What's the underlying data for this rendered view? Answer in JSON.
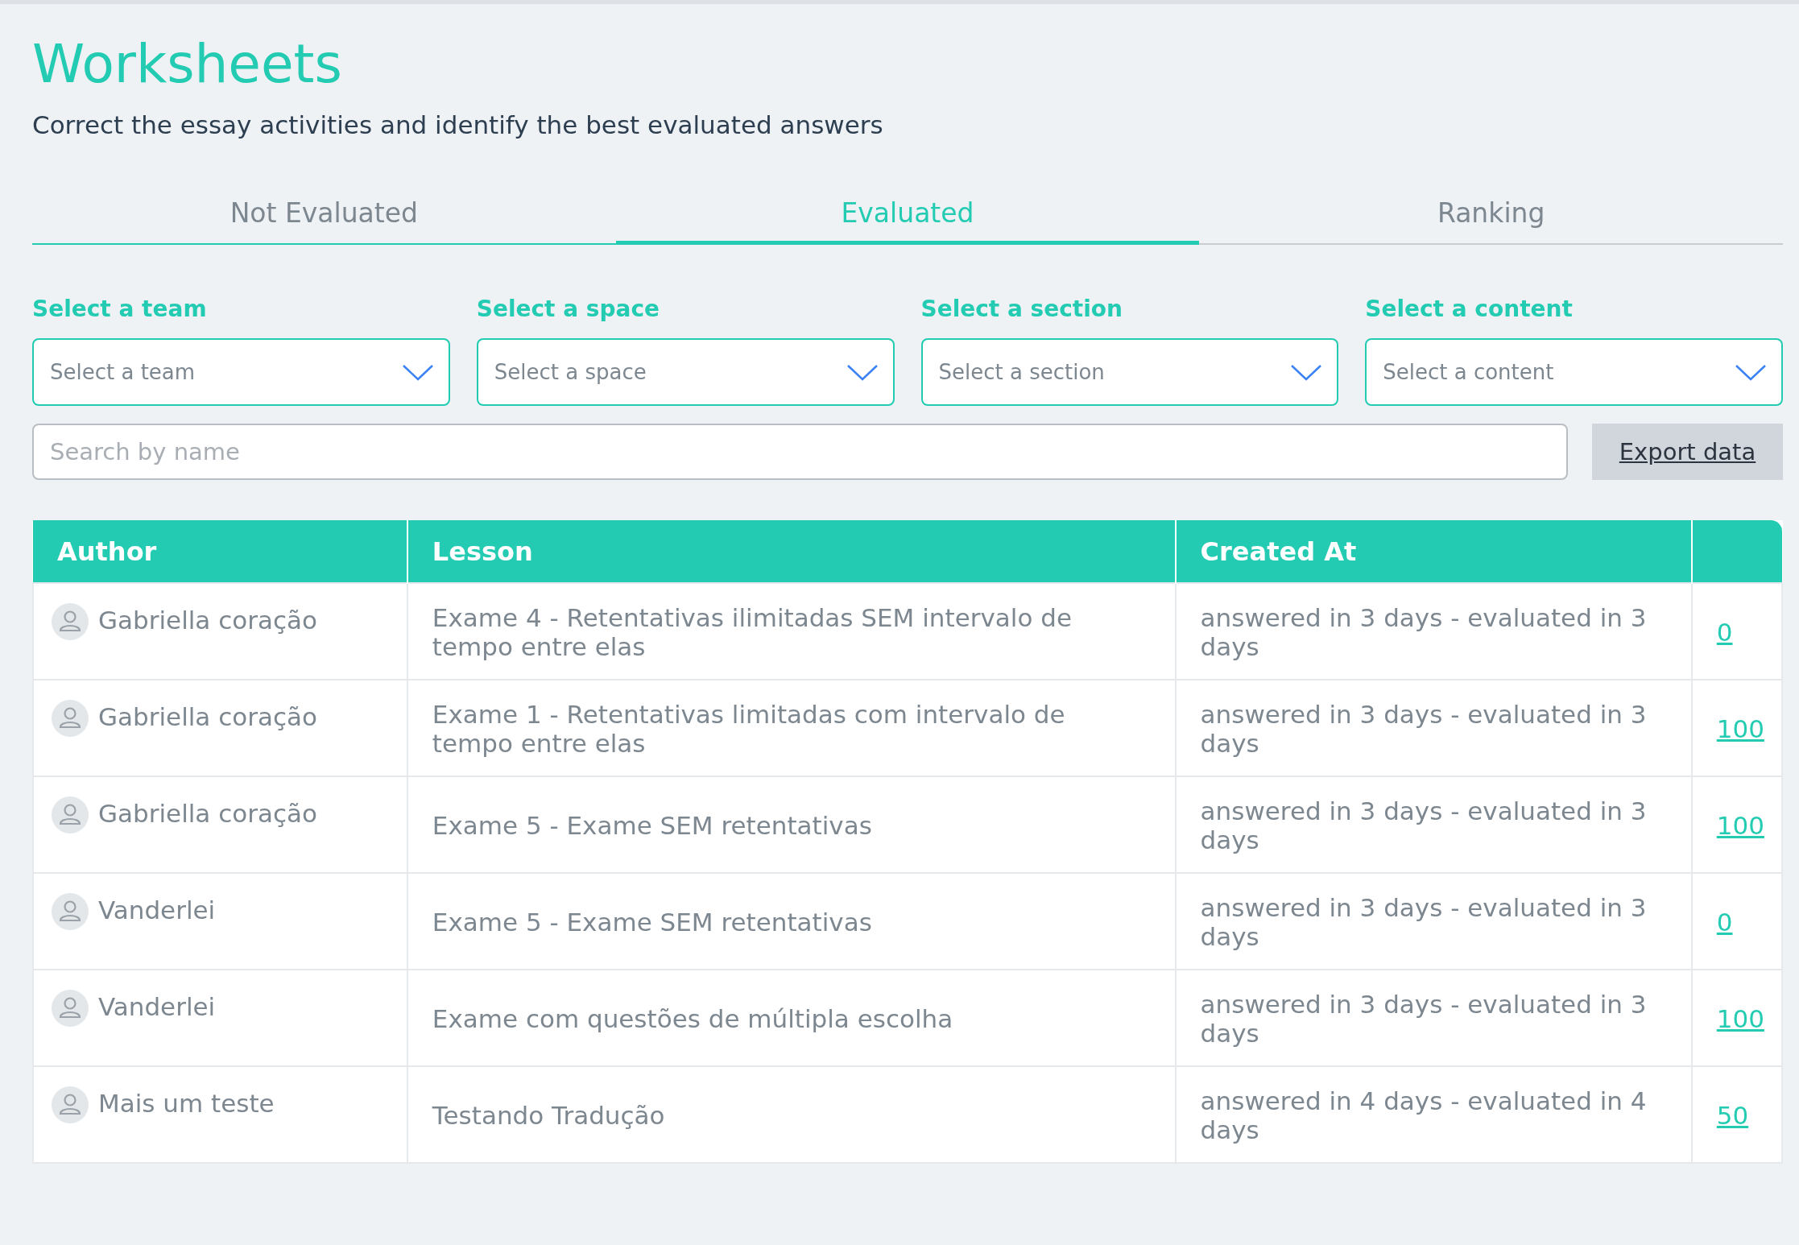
{
  "page": {
    "title": "Worksheets",
    "subtitle": "Correct the essay activities and identify the best evaluated answers"
  },
  "tabs": [
    {
      "label": "Not Evaluated",
      "selected": false
    },
    {
      "label": "Evaluated",
      "selected": true
    },
    {
      "label": "Ranking",
      "selected": false
    }
  ],
  "filters": [
    {
      "label": "Select a team",
      "placeholder": "Select a team"
    },
    {
      "label": "Select a space",
      "placeholder": "Select a space"
    },
    {
      "label": "Select a section",
      "placeholder": "Select a section"
    },
    {
      "label": "Select a content",
      "placeholder": "Select a content"
    }
  ],
  "search": {
    "placeholder": "Search by name"
  },
  "export_button": "Export data",
  "table": {
    "columns": [
      "Author",
      "Lesson",
      "Created At"
    ],
    "rows": [
      {
        "author": "Gabriella coração",
        "lesson": "Exame 4 - Retentativas ilimitadas SEM intervalo de tempo entre elas",
        "created_at": "answered in 3 days - evaluated in 3 days",
        "score": "0"
      },
      {
        "author": "Gabriella coração",
        "lesson": "Exame 1 - Retentativas limitadas com intervalo de tempo entre elas",
        "created_at": "answered in 3 days - evaluated in 3 days",
        "score": "100"
      },
      {
        "author": "Gabriella coração",
        "lesson": "Exame 5 - Exame SEM retentativas",
        "created_at": "answered in 3 days - evaluated in 3 days",
        "score": "100"
      },
      {
        "author": "Vanderlei",
        "lesson": "Exame 5 - Exame SEM retentativas",
        "created_at": "answered in 3 days - evaluated in 3 days",
        "score": "0"
      },
      {
        "author": "Vanderlei",
        "lesson": "Exame com questões de múltipla escolha",
        "created_at": "answered in 3 days - evaluated in 3 days",
        "score": "100"
      },
      {
        "author": "Mais um teste",
        "lesson": "Testando Tradução",
        "created_at": "answered in 4 days - evaluated in 4 days",
        "score": "50"
      }
    ]
  }
}
